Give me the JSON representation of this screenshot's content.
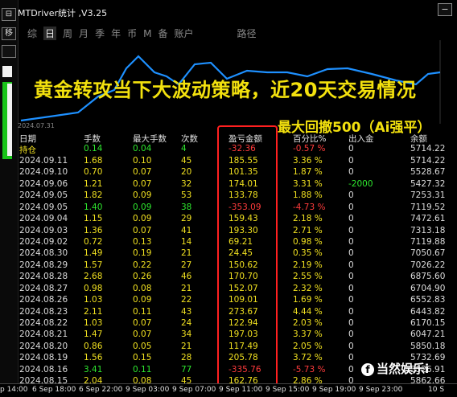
{
  "app": {
    "title": "MTDriver统计 ,V3.25"
  },
  "left_panel": {
    "btn_minus": "⊟",
    "btn_move": "移"
  },
  "tabs": [
    "综",
    "日",
    "周",
    "月",
    "季",
    "年",
    "币",
    "M",
    "备",
    "账户"
  ],
  "route_tab": "路径",
  "chart": {
    "date_label": "2024.07.31",
    "line_color": "#1e90ff"
  },
  "overlay": {
    "headline": "黄金转攻当下大波动策略，近20天交易情况",
    "subhead": "最大回撤500（Ai强平）"
  },
  "table": {
    "headers": [
      "日期",
      "手数",
      "最大手数",
      "次数",
      "盈亏金额",
      "百分比%",
      "出入金",
      "余额"
    ],
    "rows": [
      {
        "date": "持仓",
        "lots": "0.14",
        "max_lots": "0.04",
        "count": "4",
        "pnl": "-32.36",
        "pct": "-0.57 %",
        "flow": "0",
        "balance": "5714.22"
      },
      {
        "date": "2024.09.11",
        "lots": "1.68",
        "max_lots": "0.10",
        "count": "45",
        "pnl": "185.55",
        "pct": "3.36 %",
        "flow": "0",
        "balance": "5714.22"
      },
      {
        "date": "2024.09.10",
        "lots": "0.70",
        "max_lots": "0.07",
        "count": "20",
        "pnl": "101.35",
        "pct": "1.87 %",
        "flow": "0",
        "balance": "5528.67"
      },
      {
        "date": "2024.09.06",
        "lots": "1.21",
        "max_lots": "0.07",
        "count": "32",
        "pnl": "174.01",
        "pct": "3.31 %",
        "flow": "-2000",
        "balance": "5427.32"
      },
      {
        "date": "2024.09.05",
        "lots": "1.82",
        "max_lots": "0.09",
        "count": "53",
        "pnl": "133.78",
        "pct": "1.88 %",
        "flow": "0",
        "balance": "7253.31"
      },
      {
        "date": "2024.09.05",
        "lots": "1.40",
        "max_lots": "0.09",
        "count": "38",
        "pnl": "-353.09",
        "pct": "-4.73 %",
        "flow": "0",
        "balance": "7119.52"
      },
      {
        "date": "2024.09.04",
        "lots": "1.15",
        "max_lots": "0.09",
        "count": "29",
        "pnl": "159.43",
        "pct": "2.18 %",
        "flow": "0",
        "balance": "7472.61"
      },
      {
        "date": "2024.09.03",
        "lots": "1.36",
        "max_lots": "0.07",
        "count": "41",
        "pnl": "193.30",
        "pct": "2.71 %",
        "flow": "0",
        "balance": "7313.18"
      },
      {
        "date": "2024.09.02",
        "lots": "0.72",
        "max_lots": "0.13",
        "count": "14",
        "pnl": "69.21",
        "pct": "0.98 %",
        "flow": "0",
        "balance": "7119.88"
      },
      {
        "date": "2024.08.30",
        "lots": "1.49",
        "max_lots": "0.19",
        "count": "21",
        "pnl": "24.45",
        "pct": "0.35 %",
        "flow": "0",
        "balance": "7050.67"
      },
      {
        "date": "2024.08.29",
        "lots": "1.57",
        "max_lots": "0.22",
        "count": "27",
        "pnl": "150.62",
        "pct": "2.19 %",
        "flow": "0",
        "balance": "7026.22"
      },
      {
        "date": "2024.08.28",
        "lots": "2.68",
        "max_lots": "0.26",
        "count": "46",
        "pnl": "170.70",
        "pct": "2.55 %",
        "flow": "0",
        "balance": "6875.60"
      },
      {
        "date": "2024.08.27",
        "lots": "0.98",
        "max_lots": "0.08",
        "count": "21",
        "pnl": "152.07",
        "pct": "2.32 %",
        "flow": "0",
        "balance": "6704.90"
      },
      {
        "date": "2024.08.26",
        "lots": "1.03",
        "max_lots": "0.09",
        "count": "22",
        "pnl": "109.01",
        "pct": "1.69 %",
        "flow": "0",
        "balance": "6552.83"
      },
      {
        "date": "2024.08.23",
        "lots": "2.11",
        "max_lots": "0.11",
        "count": "43",
        "pnl": "273.67",
        "pct": "4.44 %",
        "flow": "0",
        "balance": "6443.82"
      },
      {
        "date": "2024.08.22",
        "lots": "1.03",
        "max_lots": "0.07",
        "count": "24",
        "pnl": "122.94",
        "pct": "2.03 %",
        "flow": "0",
        "balance": "6170.15"
      },
      {
        "date": "2024.08.21",
        "lots": "1.47",
        "max_lots": "0.07",
        "count": "34",
        "pnl": "197.03",
        "pct": "3.37 %",
        "flow": "0",
        "balance": "6047.21"
      },
      {
        "date": "2024.08.20",
        "lots": "0.86",
        "max_lots": "0.05",
        "count": "21",
        "pnl": "117.49",
        "pct": "2.05 %",
        "flow": "0",
        "balance": "5850.18"
      },
      {
        "date": "2024.08.19",
        "lots": "1.56",
        "max_lots": "0.15",
        "count": "28",
        "pnl": "205.78",
        "pct": "3.72 %",
        "flow": "0",
        "balance": "5732.69"
      },
      {
        "date": "2024.08.16",
        "lots": "3.41",
        "max_lots": "0.11",
        "count": "77",
        "pnl": "-335.76",
        "pct": "-5.73 %",
        "flow": "0",
        "balance": "5526.91"
      },
      {
        "date": "2024.08.15",
        "lots": "2.04",
        "max_lots": "0.08",
        "count": "45",
        "pnl": "162.76",
        "pct": "2.86 %",
        "flow": "0",
        "balance": "5862.66"
      }
    ]
  },
  "time_axis": [
    "p 14:00",
    "6 Sep 18:00",
    "6 Sep 22:00",
    "9 Sep 03:00",
    "9 Sep 07:00",
    "9 Sep 11:00",
    "9 Sep 15:00",
    "9 Sep 19:00",
    "9 Sep 23:00",
    "10 S"
  ],
  "watermark": {
    "icon": "f",
    "text": "当然娱乐i"
  }
}
